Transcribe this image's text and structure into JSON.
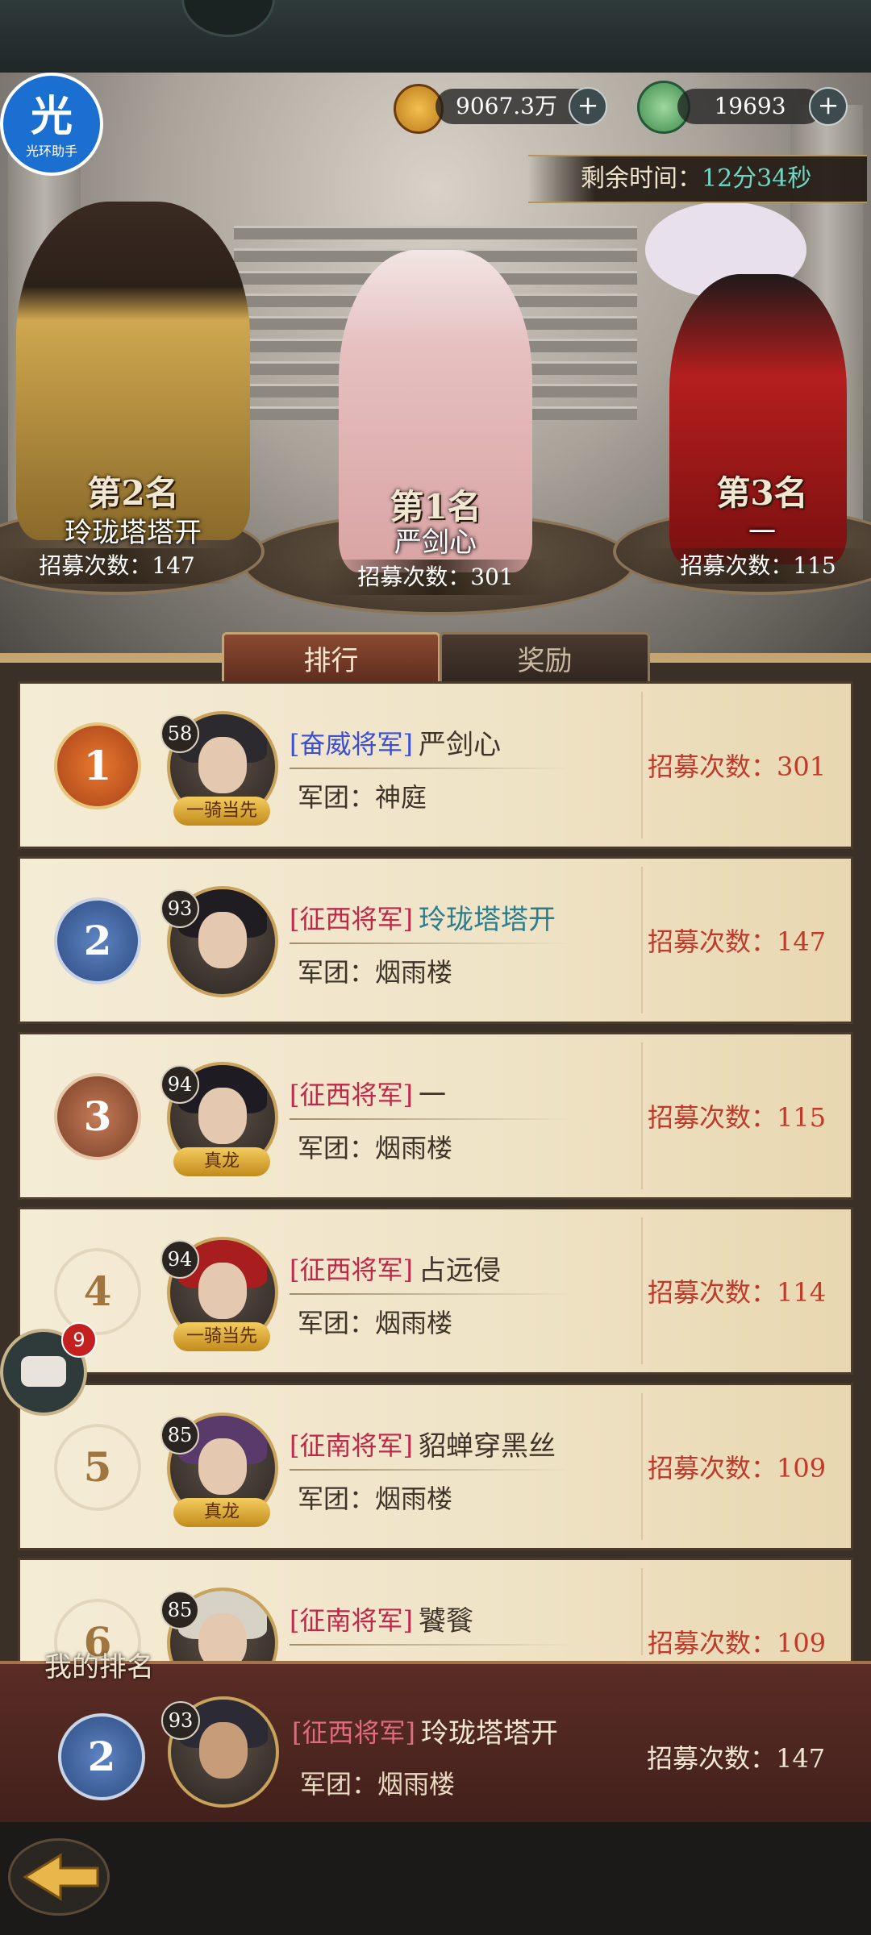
{
  "app": {
    "badge_char": "光",
    "badge_text": "光环助手"
  },
  "currency": {
    "gold": "9067.3万",
    "jade": "19693"
  },
  "timer": {
    "label": "剩余时间：",
    "value": "12分34秒"
  },
  "podium": [
    {
      "rank": "第2名",
      "name": "玲珑塔塔开",
      "recruit": "招募次数：147"
    },
    {
      "rank": "第1名",
      "name": "严剑心",
      "recruit": "招募次数：301"
    },
    {
      "rank": "第3名",
      "name": "一",
      "recruit": "招募次数：115"
    }
  ],
  "tabs": {
    "ranking": "排行",
    "rewards": "奖励"
  },
  "rows": [
    {
      "rank": "1",
      "level": "58",
      "title": "[奋威将军]",
      "name": "严剑心",
      "guild": "军团：神庭",
      "count": "招募次数：301",
      "frame": "一骑当先"
    },
    {
      "rank": "2",
      "level": "93",
      "title": "[征西将军]",
      "name": "玲珑塔塔开",
      "guild": "军团：烟雨楼",
      "count": "招募次数：147",
      "frame": ""
    },
    {
      "rank": "3",
      "level": "94",
      "title": "[征西将军]",
      "name": "一",
      "guild": "军团：烟雨楼",
      "count": "招募次数：115",
      "frame": "真龙"
    },
    {
      "rank": "4",
      "level": "94",
      "title": "[征西将军]",
      "name": "占远侵",
      "guild": "军团：烟雨楼",
      "count": "招募次数：114",
      "frame": "一骑当先"
    },
    {
      "rank": "5",
      "level": "85",
      "title": "[征南将军]",
      "name": "貂蝉穿黑丝",
      "guild": "军团：烟雨楼",
      "count": "招募次数：109",
      "frame": "真龙"
    },
    {
      "rank": "6",
      "level": "85",
      "title": "[征南将军]",
      "name": "饕餮",
      "guild": "",
      "count": "招募次数：109",
      "frame": ""
    }
  ],
  "chat": {
    "badge": "9"
  },
  "my_rank": {
    "label": "我的排名",
    "rank": "2",
    "level": "93",
    "title": "[征西将军]",
    "name": "玲珑塔塔开",
    "guild": "军团：烟雨楼",
    "count": "招募次数：147"
  },
  "colors": {
    "title_blue": "#3a4fd6",
    "title_red": "#c0284a",
    "name_teal": "#2a7d8c",
    "count_red": "#c0392b",
    "gold_accent": "#c9a35c"
  }
}
